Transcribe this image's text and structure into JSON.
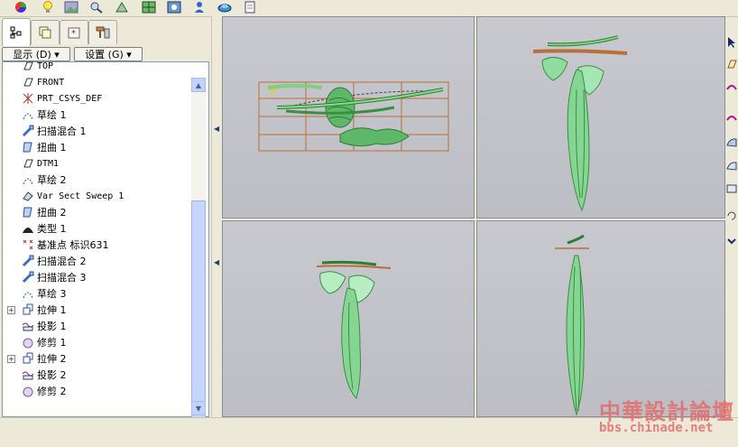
{
  "toolbar": {
    "icons": [
      "color-wheel-icon",
      "bulb-icon",
      "image-edit-icon",
      "magnifier-icon",
      "mesh-icon",
      "surface-icon",
      "photo-icon",
      "person-icon",
      "disc-icon",
      "document-icon"
    ]
  },
  "panel": {
    "tabs": [
      "model-tree-tab",
      "layer-tab",
      "favorites-tab",
      "tools-tab"
    ],
    "display_menu": "显示 (D) ▾",
    "settings_menu": "设置 (G) ▾"
  },
  "tree": {
    "items": [
      {
        "label": "TOP",
        "icon": "datum-plane-icon",
        "mono": true
      },
      {
        "label": "FRONT",
        "icon": "datum-plane-icon",
        "mono": true
      },
      {
        "label": "PRT_CSYS_DEF",
        "icon": "csys-icon",
        "mono": true
      },
      {
        "label": "草绘 1",
        "icon": "sketch-icon",
        "mono": false
      },
      {
        "label": "扫描混合 1",
        "icon": "sweep-blend-icon",
        "mono": false
      },
      {
        "label": "扭曲 1",
        "icon": "warp-icon",
        "mono": false
      },
      {
        "label": "DTM1",
        "icon": "datum-plane-icon",
        "mono": true
      },
      {
        "label": "草绘 2",
        "icon": "sketch-icon",
        "mono": false
      },
      {
        "label": "Var Sect Sweep 1",
        "icon": "var-sweep-icon",
        "mono": true
      },
      {
        "label": "扭曲 2",
        "icon": "warp-icon",
        "mono": false
      },
      {
        "label": "类型 1",
        "icon": "type-icon",
        "mono": false
      },
      {
        "label": "基准点 标识631",
        "icon": "datum-point-icon",
        "mono": false
      },
      {
        "label": "扫描混合 2",
        "icon": "sweep-blend-icon",
        "mono": false
      },
      {
        "label": "扫描混合 3",
        "icon": "sweep-blend-icon",
        "mono": false
      },
      {
        "label": "草绘 3",
        "icon": "sketch-icon",
        "mono": false
      },
      {
        "label": "拉伸 1",
        "icon": "extrude-icon",
        "mono": false,
        "expandable": true
      },
      {
        "label": "投影 1",
        "icon": "project-icon",
        "mono": false
      },
      {
        "label": "修剪 1",
        "icon": "trim-icon",
        "mono": false
      },
      {
        "label": "拉伸 2",
        "icon": "extrude-icon",
        "mono": false,
        "expandable": true
      },
      {
        "label": "投影 2",
        "icon": "project-icon",
        "mono": false
      },
      {
        "label": "修剪 2",
        "icon": "trim-icon",
        "mono": false
      }
    ]
  },
  "watermark": {
    "line1": "中華設計論壇",
    "line2": "bbs.chinade.net"
  },
  "colors": {
    "model_green": "#7fd07f",
    "model_dark": "#2e7d32",
    "grid_orange": "#b8703a",
    "viewport_bg": "#c3c3ca"
  }
}
